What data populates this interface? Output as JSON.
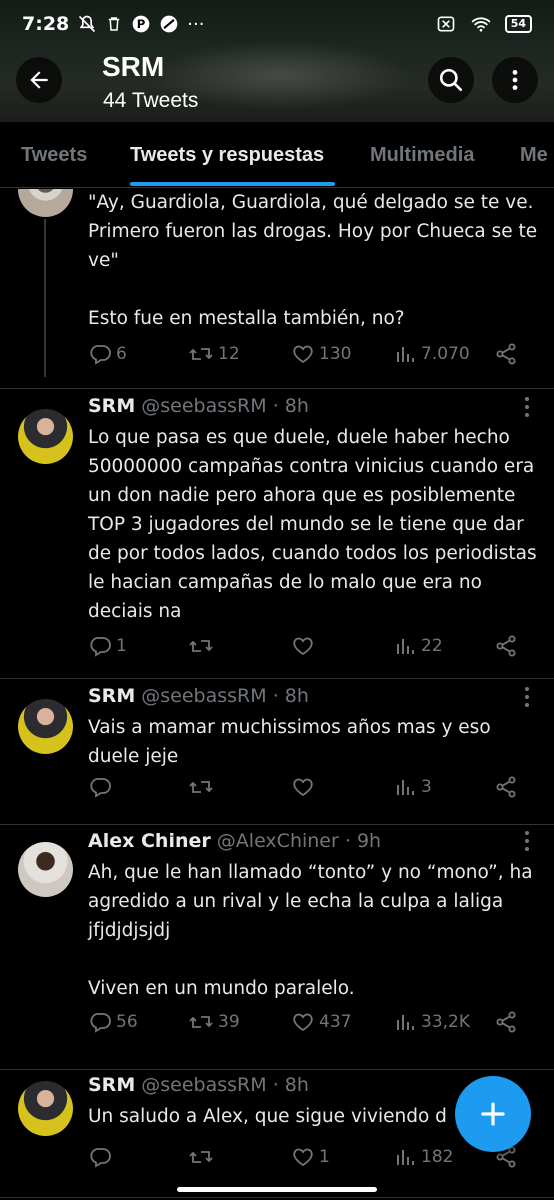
{
  "status_bar": {
    "time": "7:28",
    "battery": "54"
  },
  "header": {
    "title": "SRM",
    "subtitle": "44 Tweets"
  },
  "tabs": [
    {
      "label": "Tweets",
      "active": false
    },
    {
      "label": "Tweets y respuestas",
      "active": true
    },
    {
      "label": "Multimedia",
      "active": false
    },
    {
      "label": "Me",
      "active": false
    }
  ],
  "tweets": [
    {
      "text": "\"Ay, Guardiola, Guardiola, qué delgado se te ve. Primero fueron las drogas. Hoy por Chueca se te ve\"\n\nEsto fue en mestalla también, no?",
      "replies": "6",
      "retweets": "12",
      "likes": "130",
      "views": "7.070"
    },
    {
      "name": "SRM",
      "handle": "@seebassRM",
      "time": "8h",
      "text": "Lo que pasa es que duele, duele haber hecho 50000000 campañas contra vinicius cuando era un don nadie pero ahora que es posiblemente TOP 3 jugadores del mundo se le tiene que dar de por todos lados, cuando todos los periodistas le hacian campañas de lo malo que era no deciais na",
      "replies": "1",
      "retweets": "",
      "likes": "",
      "views": "22"
    },
    {
      "name": "SRM",
      "handle": "@seebassRM",
      "time": "8h",
      "text": "Vais a mamar muchissimos años mas y eso duele jeje",
      "replies": "",
      "retweets": "",
      "likes": "",
      "views": "3"
    },
    {
      "name": "Alex Chiner",
      "handle": "@AlexChiner",
      "time": "9h",
      "text": "Ah, que le han llamado “tonto” y no “mono”, ha agredido a un rival y le echa la culpa a laliga jfjdjdjsjdj\n\nViven en un mundo paralelo.",
      "replies": "56",
      "retweets": "39",
      "likes": "437",
      "views": "33,2K"
    },
    {
      "name": "SRM",
      "handle": "@seebassRM",
      "time": "8h",
      "text": "Un saludo a Alex, que sigue viviendo d",
      "replies": "",
      "retweets": "",
      "likes": "1",
      "views": "182"
    }
  ],
  "colors": {
    "accent": "#1d9bf0",
    "background": "#000000",
    "muted": "#71767b",
    "text": "#e7e9ea"
  },
  "icons": [
    "back-arrow-icon",
    "search-icon",
    "more-vertical-icon",
    "reply-icon",
    "retweet-icon",
    "like-icon",
    "views-icon",
    "share-icon",
    "compose-plus-icon"
  ]
}
